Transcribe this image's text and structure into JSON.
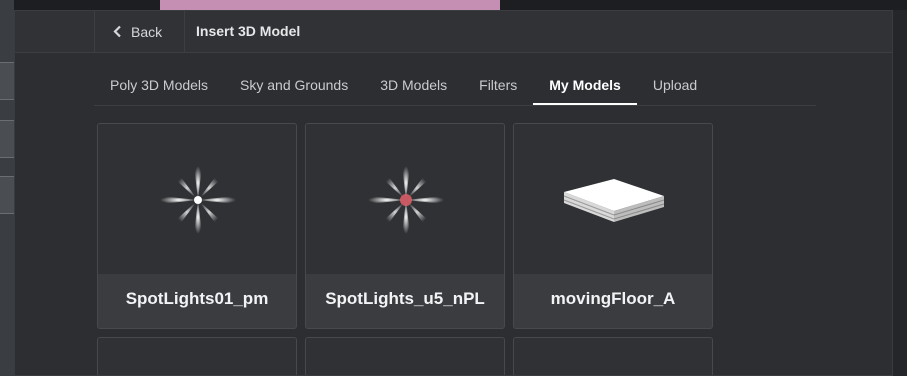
{
  "header": {
    "back_label": "Back",
    "title": "Insert 3D Model"
  },
  "tabs": [
    {
      "label": "Poly 3D Models",
      "active": false
    },
    {
      "label": "Sky and Grounds",
      "active": false
    },
    {
      "label": "3D Models",
      "active": false
    },
    {
      "label": "Filters",
      "active": false
    },
    {
      "label": "My Models",
      "active": true
    },
    {
      "label": "Upload",
      "active": false
    }
  ],
  "models": [
    {
      "name": "SpotLights01_pm",
      "thumbnail": "spotlight-white-icon"
    },
    {
      "name": "SpotLights_u5_nPL",
      "thumbnail": "spotlight-red-icon"
    },
    {
      "name": "movingFloor_A",
      "thumbnail": "floor-panel-icon"
    }
  ],
  "colors": {
    "dialog_bg": "#2c2e31",
    "card_bg": "#3a3c3f",
    "active_tab": "#ffffff"
  }
}
